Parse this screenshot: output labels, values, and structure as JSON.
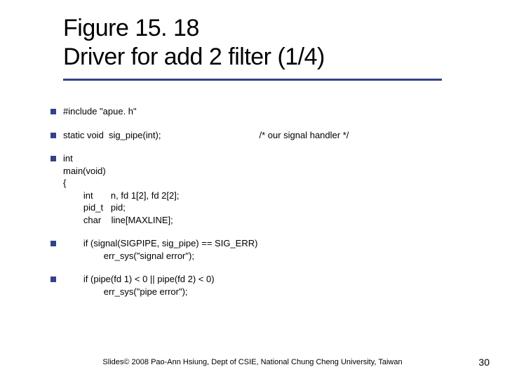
{
  "title": {
    "line1": "Figure 15. 18",
    "line2": "Driver for add 2 filter (1/4)"
  },
  "code": {
    "l1": "#include \"apue. h\"",
    "l2": "static void  sig_pipe(int);",
    "l2c": "/* our signal handler */",
    "l3": "int",
    "l4": "main(void)",
    "l5": "{",
    "l6": "        int       n, fd 1[2], fd 2[2];",
    "l7": "        pid_t   pid;",
    "l8": "        char    line[MAXLINE];",
    "l9": "        if (signal(SIGPIPE, sig_pipe) == SIG_ERR)",
    "l10": "                err_sys(\"signal error\");",
    "l11": "        if (pipe(fd 1) < 0 || pipe(fd 2) < 0)",
    "l12": "                err_sys(\"pipe error\");"
  },
  "footer": "Slides© 2008 Pao-Ann Hsiung, Dept of CSIE, National Chung Cheng University, Taiwan",
  "page": "30"
}
